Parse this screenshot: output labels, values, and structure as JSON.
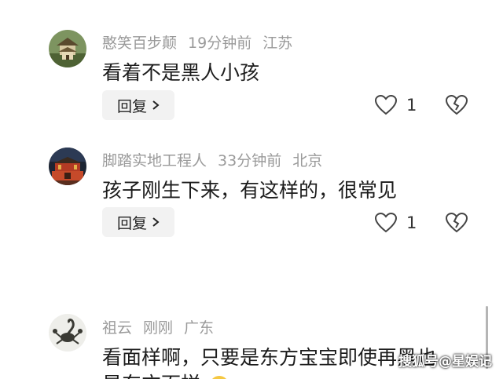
{
  "comments": [
    {
      "username": "憨笑百步颠",
      "time": "19分钟前",
      "location": "江苏",
      "text": "看着不是黑人小孩",
      "reply_label": "回复",
      "likes": "1",
      "avatar_icon": "temple-avatar"
    },
    {
      "username": "脚踏实地工程人",
      "time": "33分钟前",
      "location": "北京",
      "text": "孩子刚生下来，有这样的，很常见",
      "reply_label": "回复",
      "likes": "1",
      "avatar_icon": "tiananmen-avatar"
    },
    {
      "username": "祖云",
      "time": "刚刚",
      "location": "广东",
      "text": "看面样啊，只要是东方宝宝即使再黑也",
      "text2": "是东方面样",
      "avatar_icon": "scorpion-avatar"
    }
  ],
  "watermark": "搜狐号@星娱记",
  "colors": {
    "meta": "#9a9a9a",
    "text": "#1c1c1c",
    "reply_bg": "#f2f2f2"
  }
}
